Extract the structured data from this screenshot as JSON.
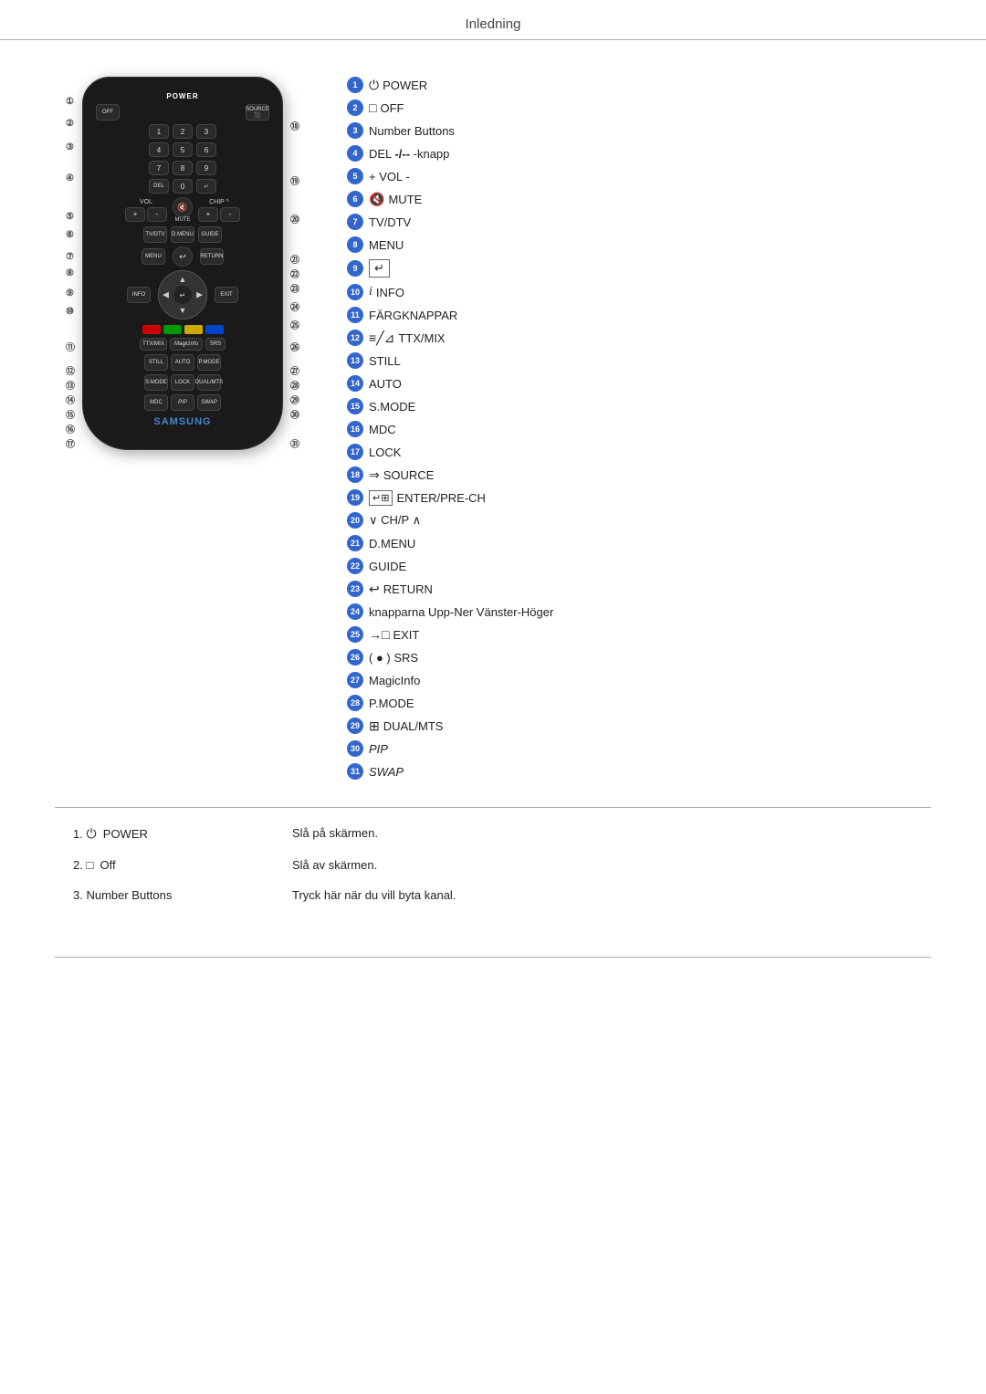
{
  "header": {
    "title": "Inledning"
  },
  "legend": [
    {
      "num": "1",
      "icon": "⏻",
      "label": "POWER"
    },
    {
      "num": "2",
      "icon": "□",
      "label": "OFF"
    },
    {
      "num": "3",
      "icon": "",
      "label": "Number Buttons"
    },
    {
      "num": "4",
      "icon": "",
      "label": "DEL -/-- -knapp"
    },
    {
      "num": "5",
      "icon": "",
      "label": "+ VOL -"
    },
    {
      "num": "6",
      "icon": "🔇",
      "label": "MUTE"
    },
    {
      "num": "7",
      "icon": "",
      "label": "TV/DTV"
    },
    {
      "num": "8",
      "icon": "",
      "label": "MENU"
    },
    {
      "num": "9",
      "icon": "↵",
      "label": ""
    },
    {
      "num": "10",
      "icon": "𝑖",
      "label": "INFO"
    },
    {
      "num": "11",
      "icon": "",
      "label": "FÄRGKNAPPAR"
    },
    {
      "num": "12",
      "icon": "",
      "label": "TTX/MIX"
    },
    {
      "num": "13",
      "icon": "",
      "label": "STILL"
    },
    {
      "num": "14",
      "icon": "",
      "label": "AUTO"
    },
    {
      "num": "15",
      "icon": "",
      "label": "S.MODE"
    },
    {
      "num": "16",
      "icon": "",
      "label": "MDC"
    },
    {
      "num": "17",
      "icon": "",
      "label": "LOCK"
    },
    {
      "num": "18",
      "icon": "⇒",
      "label": "SOURCE"
    },
    {
      "num": "19",
      "icon": "",
      "label": "ENTER/PRE-CH"
    },
    {
      "num": "20",
      "icon": "",
      "label": "∨ CH/P ∧"
    },
    {
      "num": "21",
      "icon": "",
      "label": "D.MENU"
    },
    {
      "num": "22",
      "icon": "",
      "label": "GUIDE"
    },
    {
      "num": "23",
      "icon": "↩",
      "label": "RETURN"
    },
    {
      "num": "24",
      "icon": "",
      "label": "knapparna Upp-Ner Vänster-Höger"
    },
    {
      "num": "25",
      "icon": "→□",
      "label": "EXIT"
    },
    {
      "num": "26",
      "icon": "",
      "label": "( ● ) SRS"
    },
    {
      "num": "27",
      "icon": "",
      "label": "MagicInfo"
    },
    {
      "num": "28",
      "icon": "",
      "label": "P.MODE"
    },
    {
      "num": "29",
      "icon": "⊞",
      "label": "DUAL/MTS"
    },
    {
      "num": "30",
      "icon": "",
      "label": "PIP",
      "italic": true
    },
    {
      "num": "31",
      "icon": "",
      "label": "SWAP",
      "italic": true
    }
  ],
  "descriptions": [
    {
      "label": "1. ⏻  POWER",
      "text": "Slå på skärmen."
    },
    {
      "label": "2. □  Off",
      "text": "Slå av skärmen."
    },
    {
      "label": "3. Number Buttons",
      "text": "Tryck här när du vill byta kanal."
    }
  ],
  "remote": {
    "brand": "SAMSUNG",
    "power_label": "POWER",
    "chip_label": "CHIP ^"
  }
}
